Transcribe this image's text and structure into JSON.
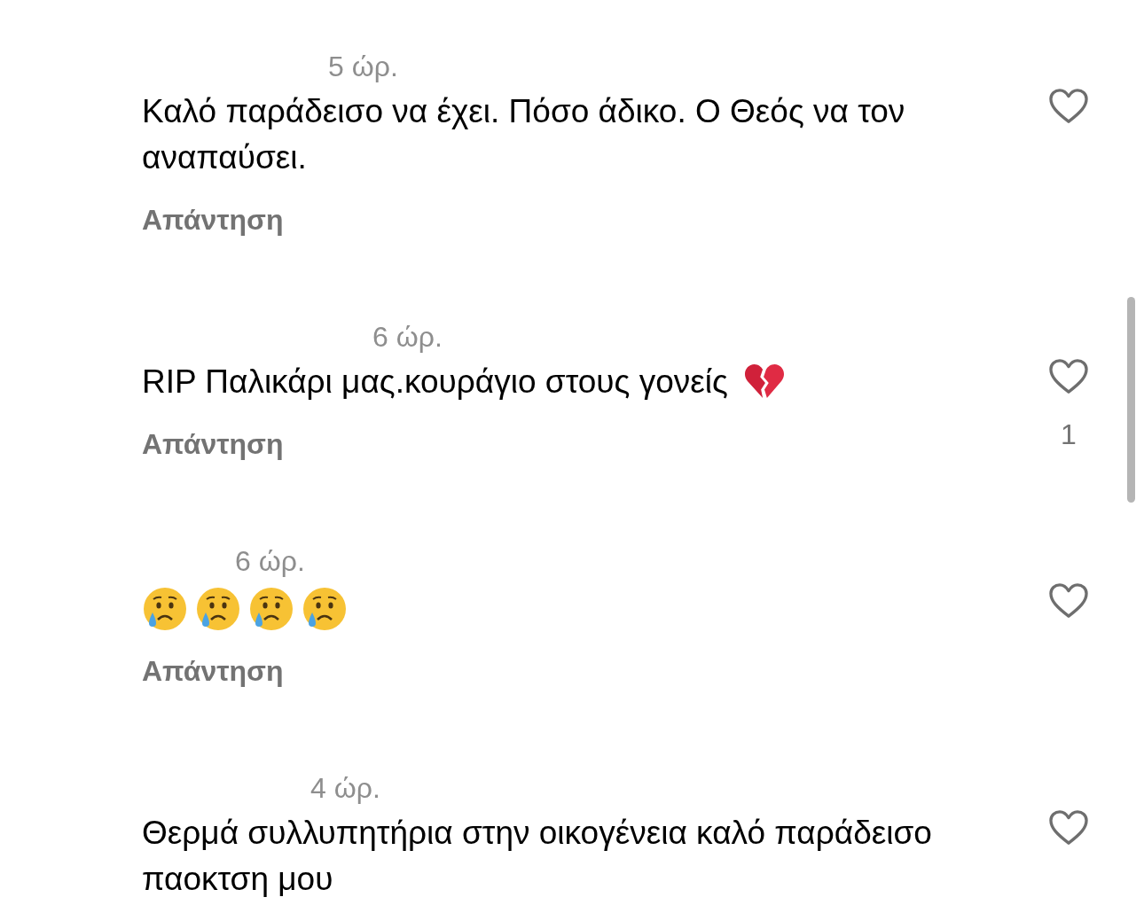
{
  "comments": [
    {
      "time": "5 ώρ.",
      "kind": "text",
      "text": "Καλό παράδεισο να έχει. Πόσο άδικο. Ο Θεός να τον αναπαύσει.",
      "reply": "Απάντηση",
      "liked": false
    },
    {
      "time": "6 ώρ.",
      "kind": "text",
      "text": "RIP Παλικάρι μας.κουράγιο στους γονείς",
      "trailing_icons": [
        {
          "kind": "broken-heart"
        }
      ],
      "reply": "Απάντηση",
      "liked": false,
      "like_count": "1"
    },
    {
      "time": "6 ώρ.",
      "kind": "emoji",
      "emojis": [
        {
          "kind": "crying-face"
        },
        {
          "kind": "crying-face"
        },
        {
          "kind": "crying-face"
        },
        {
          "kind": "crying-face"
        }
      ],
      "reply": "Απάντηση",
      "liked": false
    },
    {
      "time": "4 ώρ.",
      "kind": "text",
      "text": "Θερμά συλλυπητήρια στην οικογένεια καλό παράδεισο παοκτση μου",
      "liked": false
    }
  ]
}
